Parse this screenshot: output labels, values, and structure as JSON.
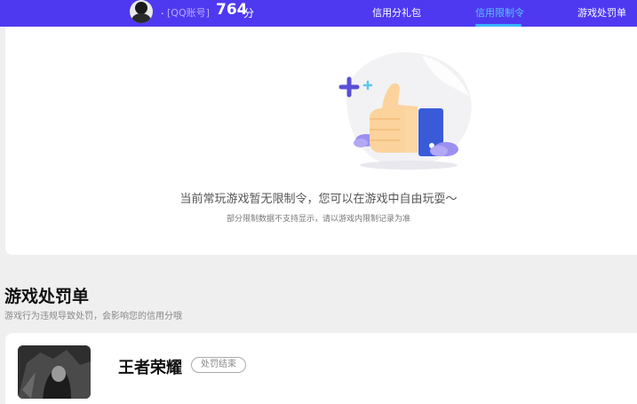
{
  "header": {
    "nickname": ".",
    "account_tag": "[QQ账号]",
    "score": "764",
    "score_unit": "分",
    "nav": [
      {
        "label": "信用分礼包",
        "active": false
      },
      {
        "label": "信用限制令",
        "active": true
      },
      {
        "label": "游戏处罚单",
        "active": false
      }
    ],
    "accent_color": "#4f39f0",
    "active_color": "#56c4ff"
  },
  "restriction": {
    "illustration": "thumbs-up-icon",
    "message": "当前常玩游戏暂无限制令，您可以在游戏中自由玩耍～",
    "note": "部分限制数据不支持显示，请以游戏内限制记录为准"
  },
  "penalty": {
    "title": "游戏处罚单",
    "description": "游戏行为违规导致处罚，会影响您的信用分哦",
    "items": [
      {
        "game": "王者荣耀",
        "status": "处罚结束"
      }
    ]
  }
}
